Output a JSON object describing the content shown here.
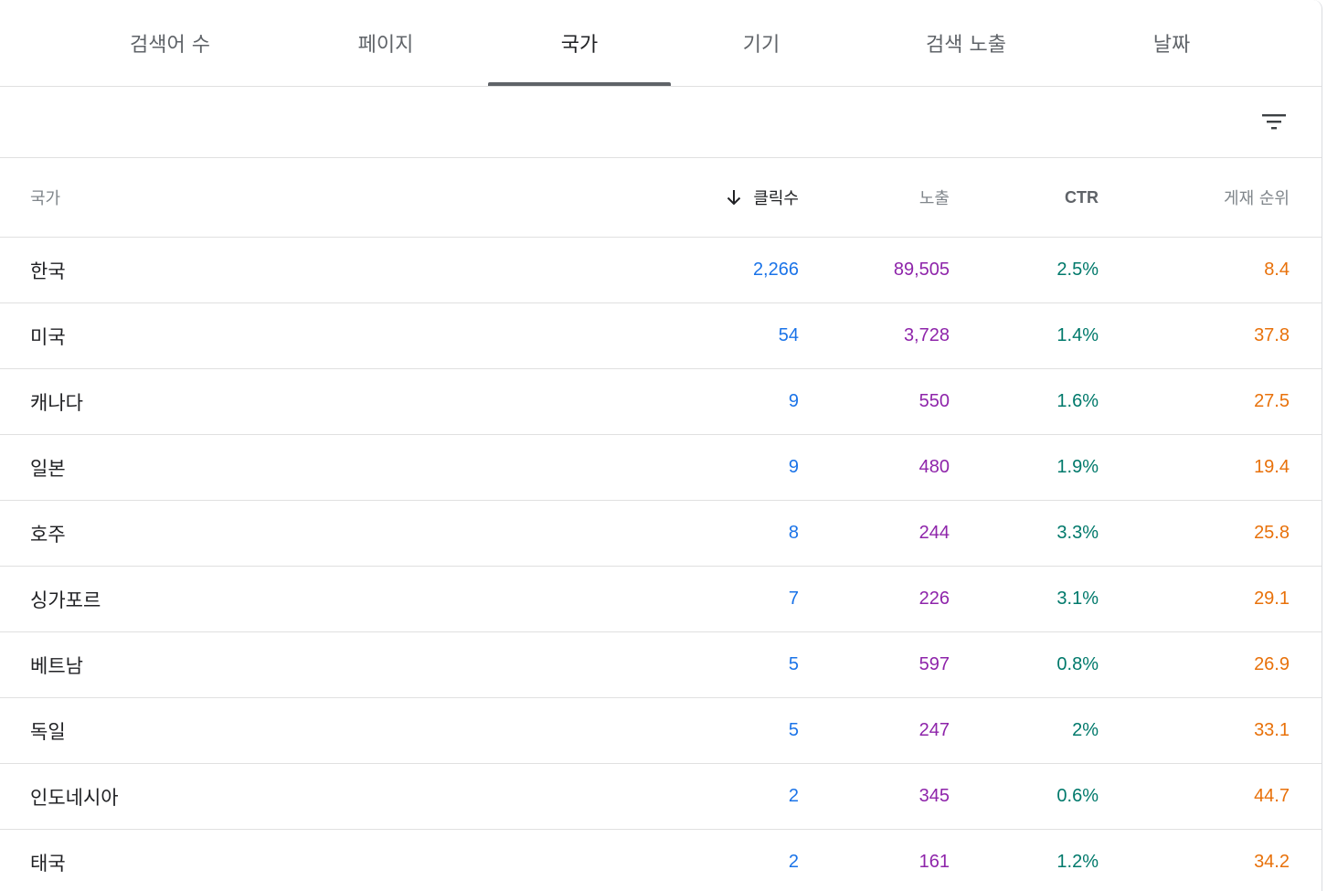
{
  "tabs": [
    {
      "label": "검색어 수"
    },
    {
      "label": "페이지"
    },
    {
      "label": "국가"
    },
    {
      "label": "기기"
    },
    {
      "label": "검색 노출"
    },
    {
      "label": "날짜"
    }
  ],
  "active_tab": "국가",
  "filter": {
    "icon": "filter-icon"
  },
  "table": {
    "headers": {
      "country": "국가",
      "clicks": "클릭수",
      "impressions": "노출",
      "ctr": "CTR",
      "position": "게재 순위"
    },
    "sort": {
      "column": "clicks",
      "direction": "descending",
      "icon": "arrow-down-icon"
    },
    "rows": [
      {
        "country": "한국",
        "clicks": "2,266",
        "impressions": "89,505",
        "ctr": "2.5%",
        "position": "8.4"
      },
      {
        "country": "미국",
        "clicks": "54",
        "impressions": "3,728",
        "ctr": "1.4%",
        "position": "37.8"
      },
      {
        "country": "캐나다",
        "clicks": "9",
        "impressions": "550",
        "ctr": "1.6%",
        "position": "27.5"
      },
      {
        "country": "일본",
        "clicks": "9",
        "impressions": "480",
        "ctr": "1.9%",
        "position": "19.4"
      },
      {
        "country": "호주",
        "clicks": "8",
        "impressions": "244",
        "ctr": "3.3%",
        "position": "25.8"
      },
      {
        "country": "싱가포르",
        "clicks": "7",
        "impressions": "226",
        "ctr": "3.1%",
        "position": "29.1"
      },
      {
        "country": "베트남",
        "clicks": "5",
        "impressions": "597",
        "ctr": "0.8%",
        "position": "26.9"
      },
      {
        "country": "독일",
        "clicks": "5",
        "impressions": "247",
        "ctr": "2%",
        "position": "33.1"
      },
      {
        "country": "인도네시아",
        "clicks": "2",
        "impressions": "345",
        "ctr": "0.6%",
        "position": "44.7"
      },
      {
        "country": "태국",
        "clicks": "2",
        "impressions": "161",
        "ctr": "1.2%",
        "position": "34.2"
      }
    ]
  },
  "colors": {
    "clicks": "#1a73e8",
    "impressions": "#8e24aa",
    "ctr": "#00796b",
    "position": "#e8710a"
  }
}
